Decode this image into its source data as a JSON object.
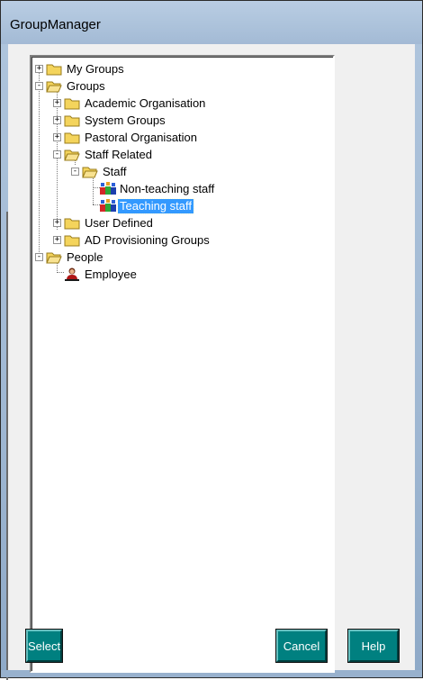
{
  "window": {
    "title": "GroupManager"
  },
  "tree": {
    "nodes": [
      {
        "label": "My Groups",
        "icon": "folder-closed-icon",
        "expander": "+"
      },
      {
        "label": "Groups",
        "icon": "folder-open-icon",
        "expander": "-"
      },
      {
        "label": "Academic Organisation",
        "icon": "folder-closed-icon",
        "expander": "+"
      },
      {
        "label": "System Groups",
        "icon": "folder-closed-icon",
        "expander": "+"
      },
      {
        "label": "Pastoral Organisation",
        "icon": "folder-closed-icon",
        "expander": "+"
      },
      {
        "label": "Staff Related",
        "icon": "folder-open-icon",
        "expander": "-"
      },
      {
        "label": "Staff",
        "icon": "folder-open-icon",
        "expander": "-"
      },
      {
        "label": "Non-teaching staff",
        "icon": "group-icon",
        "expander": ""
      },
      {
        "label": "Teaching staff",
        "icon": "group-icon",
        "expander": "",
        "selected": true
      },
      {
        "label": "User Defined",
        "icon": "folder-closed-icon",
        "expander": "+"
      },
      {
        "label": "AD Provisioning Groups",
        "icon": "folder-closed-icon",
        "expander": "+"
      },
      {
        "label": "People",
        "icon": "folder-open-icon",
        "expander": "-"
      },
      {
        "label": "Employee",
        "icon": "person-icon",
        "expander": ""
      }
    ]
  },
  "buttons": {
    "select": "Select",
    "cancel": "Cancel",
    "help": "Help"
  },
  "colors": {
    "button_bg": "#008080",
    "selection_bg": "#3399ff",
    "titlebar": "#aec4dc"
  }
}
